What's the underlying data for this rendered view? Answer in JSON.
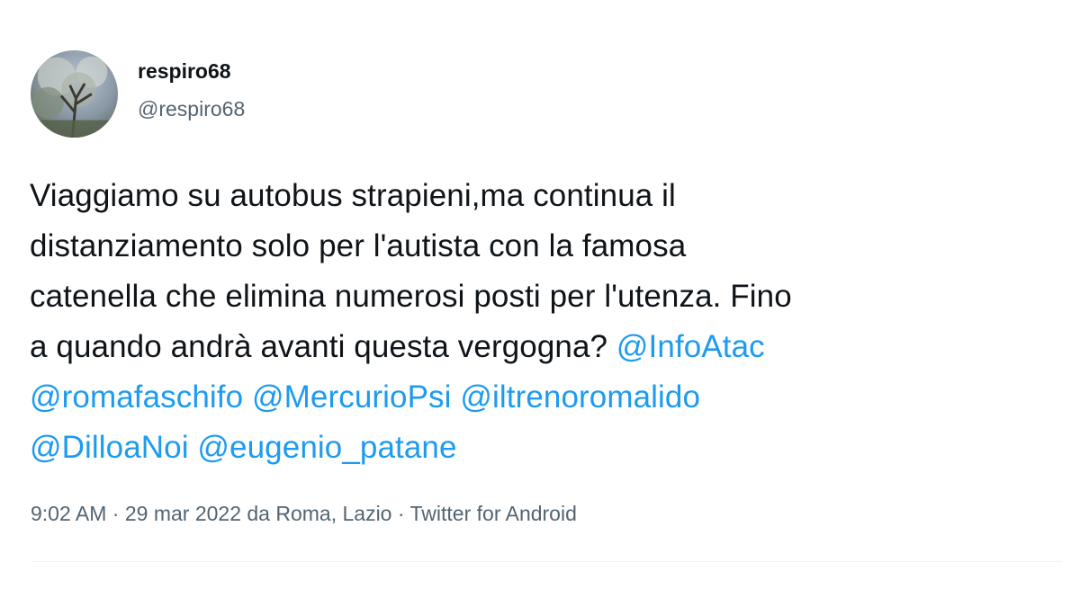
{
  "user": {
    "display_name": "respiro68",
    "handle": "@respiro68",
    "avatar_icon": "profile-photo-tree-icon"
  },
  "tweet": {
    "text_lines": [
      "Viaggiamo su autobus strapieni,ma continua il",
      "distanziamento solo per l'autista con la famosa",
      "catenella che elimina numerosi posti per l'utenza. Fino",
      "a quando andrà avanti questa vergogna?"
    ],
    "mentions": [
      "@InfoAtac",
      "@romafaschifo",
      "@MercurioPsi",
      "@iltrenoromalido",
      "@DilloaNoi",
      "@eugenio_patane"
    ]
  },
  "meta": {
    "time": "9:02 AM",
    "separator": "·",
    "date": "29 mar 2022",
    "location": "da Roma, Lazio",
    "source": "Twitter for Android"
  },
  "colors": {
    "mention": "#1d9bf0",
    "secondary_text": "#536471",
    "primary_text": "#0f1419"
  }
}
